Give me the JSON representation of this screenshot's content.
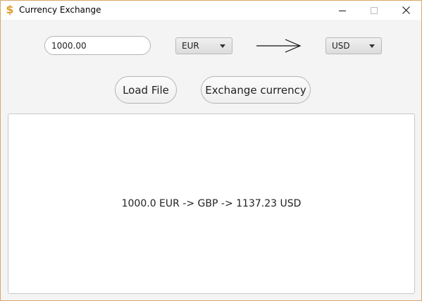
{
  "window": {
    "title": "Currency Exchange",
    "icon": "dollar-icon",
    "icon_glyph": "$",
    "icon_color": "#e0a030",
    "border_color": "#d9a66a",
    "controls": [
      "minimize-icon",
      "maximize-icon",
      "close-icon"
    ]
  },
  "form": {
    "amount_value": "1000.00",
    "from_currency": "EUR",
    "to_currency": "USD",
    "direction_icon": "arrow-right-icon"
  },
  "buttons": {
    "load_label": "Load File",
    "exchange_label": "Exchange currency"
  },
  "result": {
    "text": "1000.0 EUR -> GBP -> 1137.23 USD"
  }
}
